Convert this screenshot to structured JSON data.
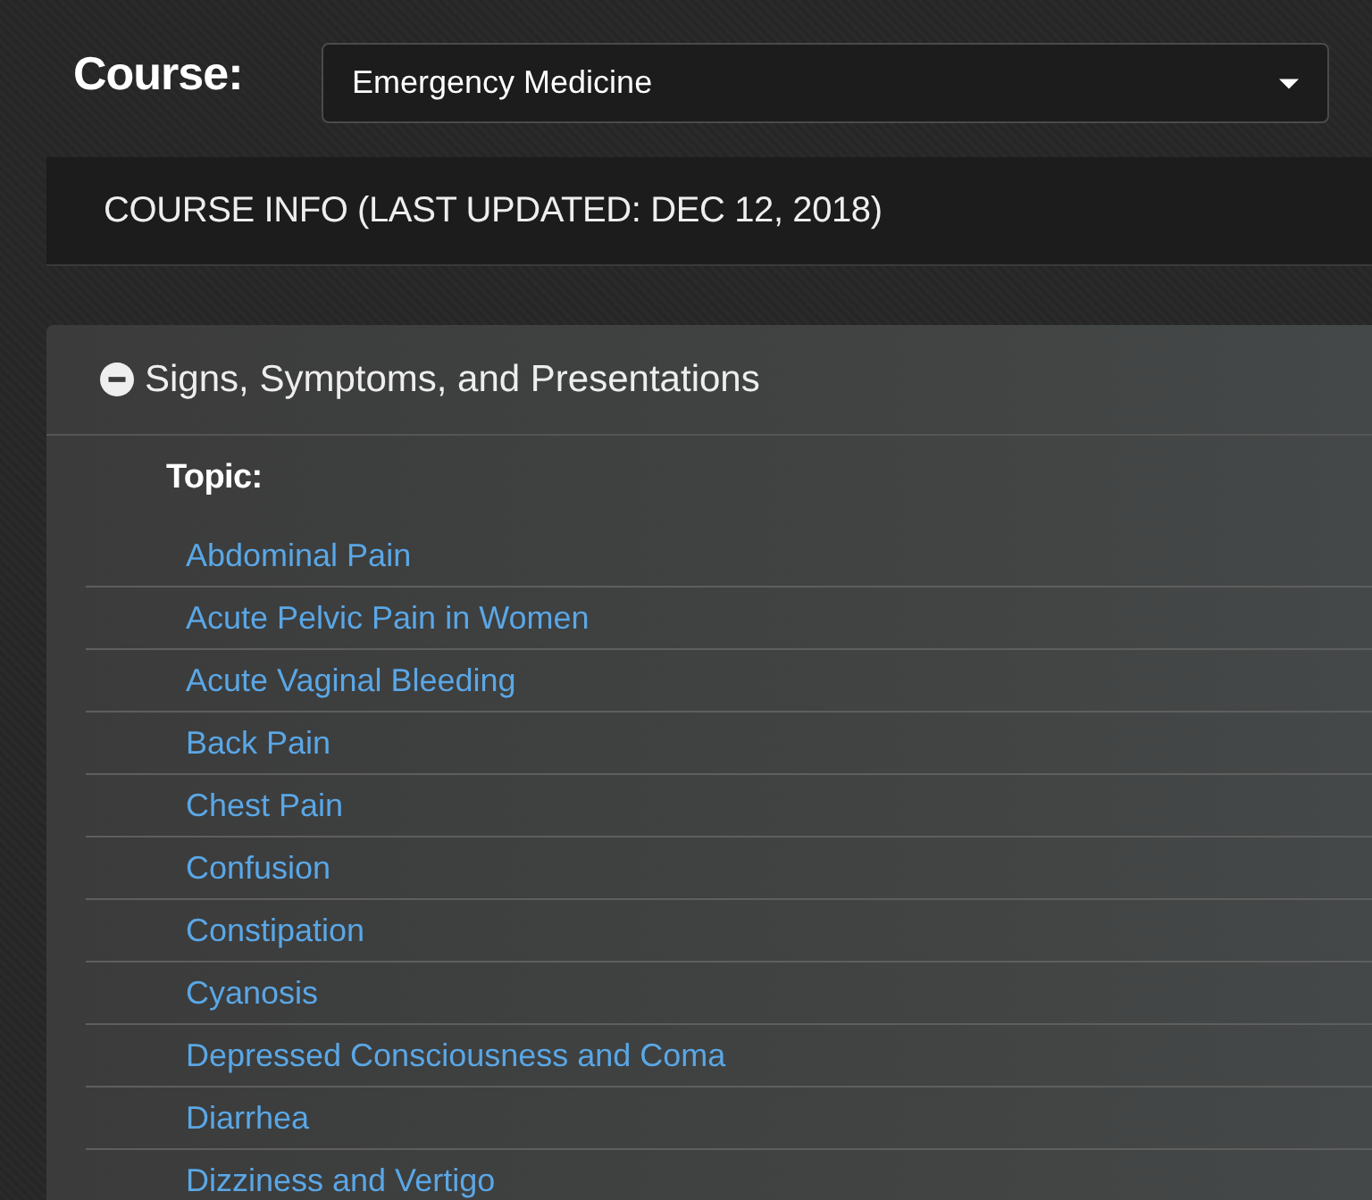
{
  "course": {
    "label": "Course:",
    "value": "Emergency Medicine"
  },
  "course_info": {
    "title": "COURSE INFO (LAST UPDATED: DEC 12, 2018)"
  },
  "section": {
    "title": "Signs, Symptoms, and Presentations",
    "expanded": true,
    "topic_label": "Topic:",
    "topics": [
      "Abdominal Pain",
      "Acute Pelvic Pain in Women",
      "Acute Vaginal Bleeding",
      "Back Pain",
      "Chest Pain",
      "Confusion",
      "Constipation",
      "Cyanosis",
      "Depressed Consciousness and Coma",
      "Diarrhea",
      "Dizziness and Vertigo"
    ]
  }
}
